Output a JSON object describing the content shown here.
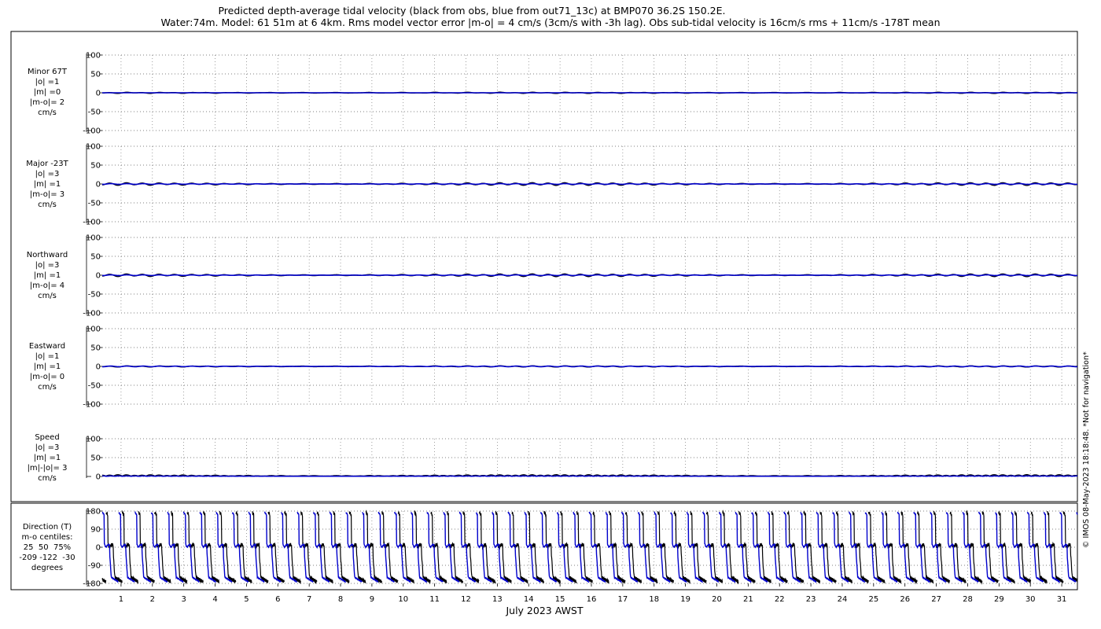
{
  "chart_data": {
    "type": "line",
    "title": "Predicted depth-average tidal velocity (black from obs, blue from out71_13c) at BMP070 36.2S 150.2E.",
    "subtitle": "Water:74m. Model: 61 51m at 6 4km. Rms model vector error |m-o| = 4 cm/s (3cm/s with -3h lag). Obs sub-tidal velocity is 16cm/s rms + 11cm/s -178T mean",
    "xlabel": "July 2023 AWST",
    "x_ticks": [
      "1",
      "2",
      "3",
      "4",
      "5",
      "6",
      "7",
      "8",
      "9",
      "10",
      "11",
      "12",
      "13",
      "14",
      "15",
      "16",
      "17",
      "18",
      "19",
      "20",
      "21",
      "22",
      "23",
      "24",
      "25",
      "26",
      "27",
      "28",
      "29",
      "30",
      "31"
    ],
    "xlim": [
      0.4,
      31.5
    ],
    "grid": true,
    "series_colors": {
      "obs": "#000000",
      "model": "#0000cc"
    },
    "panels": [
      {
        "label": "Minor 67T\n|o| =1\n|m| =0\n|m-o|= 2\ncm/s",
        "ylim": [
          -100,
          100
        ],
        "yticks": [
          "100",
          "50",
          "0",
          "-50",
          "-100"
        ],
        "obs_amplitude": 1,
        "model_amplitude": 0
      },
      {
        "label": "Major -23T\n|o| =3\n|m| =1\n|m-o|= 3\ncm/s",
        "ylim": [
          -100,
          100
        ],
        "yticks": [
          "100",
          "50",
          "0",
          "-50",
          "-100"
        ],
        "obs_amplitude": 3,
        "model_amplitude": 1
      },
      {
        "label": "Northward\n|o| =3\n|m| =1\n|m-o|= 4\ncm/s",
        "ylim": [
          -100,
          100
        ],
        "yticks": [
          "100",
          "50",
          "0",
          "-50",
          "-100"
        ],
        "obs_amplitude": 3,
        "model_amplitude": 1
      },
      {
        "label": "Eastward\n|o| =1\n|m| =1\n|m-o|= 0\ncm/s",
        "ylim": [
          -100,
          100
        ],
        "yticks": [
          "100",
          "50",
          "0",
          "-50",
          "-100"
        ],
        "obs_amplitude": 1,
        "model_amplitude": 1
      },
      {
        "label": "Speed\n|o| =3\n|m| =1\n|m|-|o|= 3\ncm/s",
        "ylim": [
          0,
          100
        ],
        "yticks": [
          "100",
          "50",
          "0"
        ],
        "obs_amplitude": 3,
        "model_amplitude": 1
      },
      {
        "label": "Direction (T)\nm-o centiles:\n25  50  75%\n-209 -122  -30\ndegrees",
        "ylim": [
          -180,
          180
        ],
        "yticks": [
          "180",
          "90",
          "0",
          "-90",
          "-180"
        ]
      }
    ]
  },
  "credit": "© IMOS 08-May-2023 18:18:48. *Not for navigation*"
}
